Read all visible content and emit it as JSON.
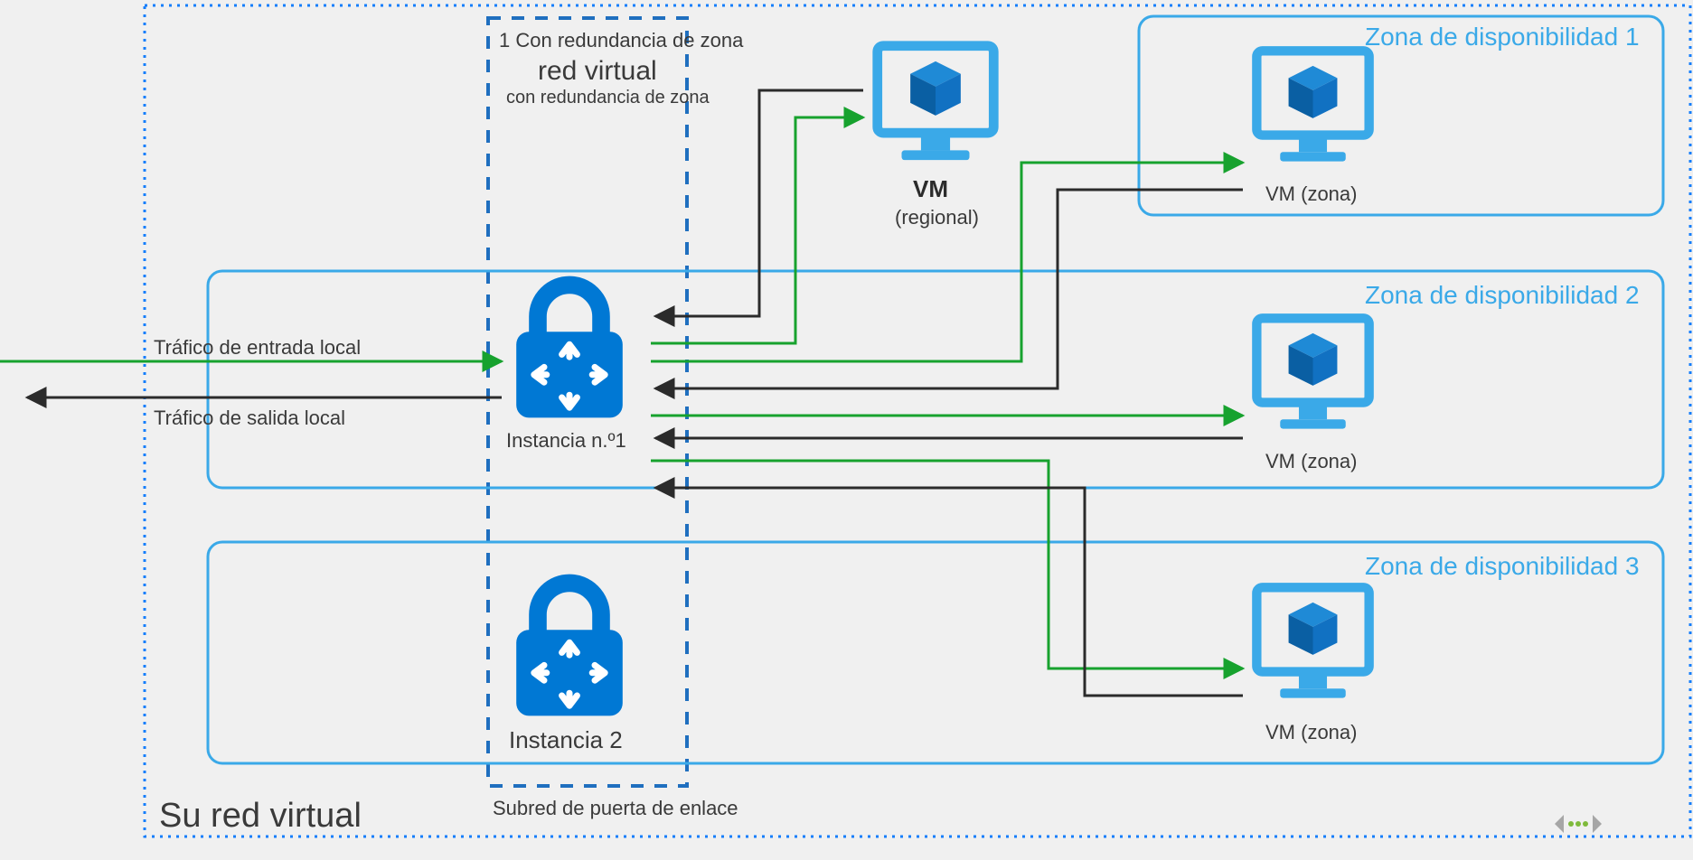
{
  "vnet": {
    "title": "Su red virtual",
    "gateway_subnet_title": "1 Con redundancia de zona",
    "gateway_subnet_subtitle": "red virtual",
    "gateway_subnet_note": "con redundancia de zona",
    "gateway_subnet_caption": "Subred de puerta de enlace",
    "instances": {
      "inst1": "Instancia n.º1",
      "inst2": "Instancia 2"
    }
  },
  "traffic": {
    "inbound": "Tráfico de entrada local",
    "outbound": "Tráfico de salida local"
  },
  "zones": {
    "z1": "Zona de disponibilidad 1",
    "z2": "Zona de disponibilidad 2",
    "z3": "Zona de disponibilidad 3"
  },
  "vms": {
    "regional_title": "VM",
    "regional_sub": "(regional)",
    "zonal": "VM (zona)"
  },
  "footer_marker": "<…>"
}
